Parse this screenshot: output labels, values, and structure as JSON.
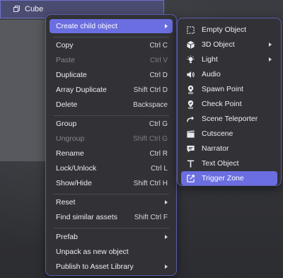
{
  "header": {
    "title": "Cube",
    "icon": "cube-icon"
  },
  "main_menu": {
    "items": [
      {
        "label": "Create child object",
        "shortcut": "",
        "submenu": true,
        "state": "active"
      },
      {
        "label": "Copy",
        "shortcut": "Ctrl C"
      },
      {
        "label": "Paste",
        "shortcut": "Ctrl V",
        "state": "disabled"
      },
      {
        "label": "Duplicate",
        "shortcut": "Ctrl D"
      },
      {
        "label": "Array Duplicate",
        "shortcut": "Shift Ctrl D"
      },
      {
        "label": "Delete",
        "shortcut": "Backspace"
      },
      {
        "label": "Group",
        "shortcut": "Ctrl G"
      },
      {
        "label": "Ungroup",
        "shortcut": "Shift Ctrl G",
        "state": "disabled"
      },
      {
        "label": "Rename",
        "shortcut": "Ctrl R"
      },
      {
        "label": "Lock/Unlock",
        "shortcut": "Ctrl L"
      },
      {
        "label": "Show/Hide",
        "shortcut": "Shift Ctrl H"
      },
      {
        "label": "Reset",
        "shortcut": "",
        "submenu": true
      },
      {
        "label": "Find similar assets",
        "shortcut": "Shift Ctrl F"
      },
      {
        "label": "Prefab",
        "shortcut": "",
        "submenu": true
      },
      {
        "label": "Unpack as new object",
        "shortcut": ""
      },
      {
        "label": "Publish to Asset Library",
        "shortcut": "",
        "submenu": true
      }
    ]
  },
  "sub_menu": {
    "items": [
      {
        "label": "Empty Object",
        "icon": "dashed-square-icon"
      },
      {
        "label": "3D Object",
        "icon": "cube-3d-icon",
        "submenu": true
      },
      {
        "label": "Light",
        "icon": "lightbulb-icon",
        "submenu": true
      },
      {
        "label": "Audio",
        "icon": "speaker-icon"
      },
      {
        "label": "Spawn Point",
        "icon": "map-pin-icon"
      },
      {
        "label": "Check Point",
        "icon": "check-pin-icon"
      },
      {
        "label": "Scene Teleporter",
        "icon": "forward-arrow-icon"
      },
      {
        "label": "Cutscene",
        "icon": "clapperboard-icon"
      },
      {
        "label": "Narrator",
        "icon": "speech-bubble-icon"
      },
      {
        "label": "Text Object",
        "icon": "text-t-icon"
      },
      {
        "label": "Trigger Zone",
        "icon": "trigger-zone-icon",
        "state": "active"
      }
    ]
  },
  "colors": {
    "accent": "#6b6ee0",
    "menu_bg": "#323236",
    "menu_border": "#5b5da8",
    "disabled_text": "#85858c"
  }
}
